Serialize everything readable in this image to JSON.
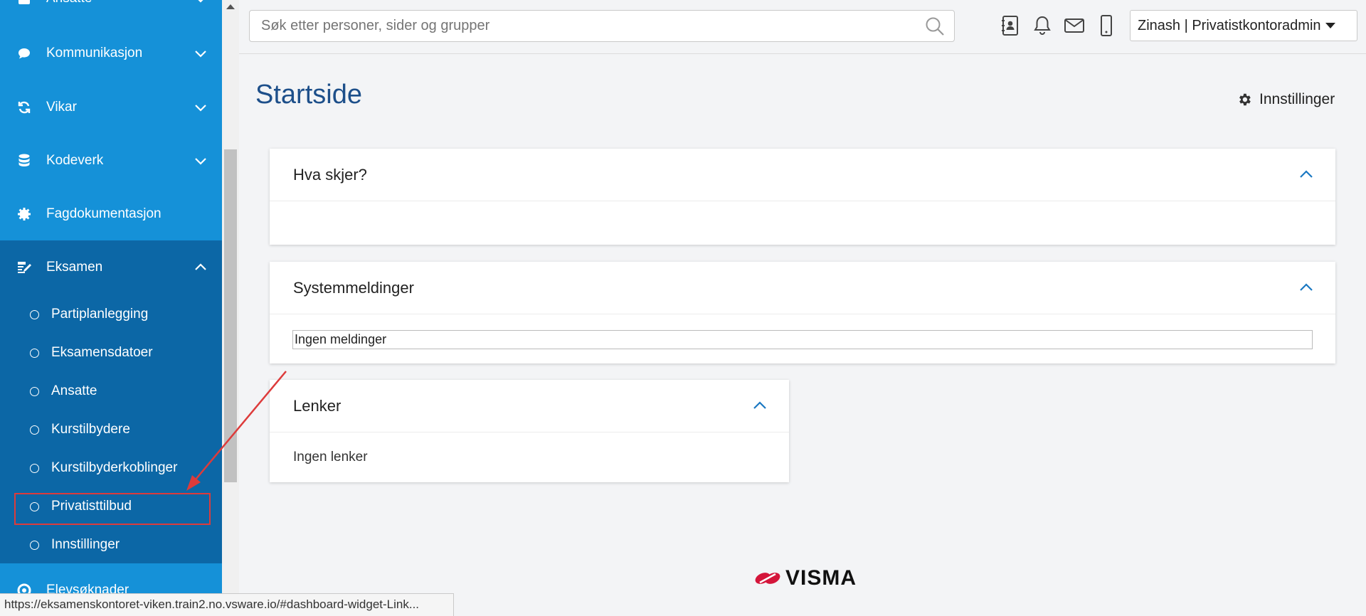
{
  "sidebar": {
    "items": [
      {
        "label": "Ansatte",
        "icon": "id-card-icon"
      },
      {
        "label": "Kommunikasjon",
        "icon": "chat-bubble-icon"
      },
      {
        "label": "Vikar",
        "icon": "refresh-icon"
      },
      {
        "label": "Kodeverk",
        "icon": "database-icon"
      },
      {
        "label": "Fagdokumentasjon",
        "icon": "gear-icon"
      },
      {
        "label": "Eksamen",
        "icon": "edit-document-icon"
      },
      {
        "label": "Elevsøknader",
        "icon": "life-ring-icon"
      }
    ],
    "subitems": [
      {
        "label": "Partiplanlegging"
      },
      {
        "label": "Eksamensdatoer"
      },
      {
        "label": "Ansatte"
      },
      {
        "label": "Kurstilbydere"
      },
      {
        "label": "Kurstilbyderkoblinger"
      },
      {
        "label": "Privatisttilbud",
        "highlighted": true
      },
      {
        "label": "Innstillinger"
      }
    ]
  },
  "topbar": {
    "search_placeholder": "Søk etter personer, sider og grupper",
    "user_label": "Zinash | Privatistkontoradmin"
  },
  "page": {
    "title": "Startside",
    "settings_label": "Innstillinger"
  },
  "cards": {
    "hva_skjer": {
      "title": "Hva skjer?"
    },
    "systemmeldinger": {
      "title": "Systemmeldinger",
      "message": "Ingen meldinger"
    },
    "lenker": {
      "title": "Lenker",
      "message": "Ingen lenker"
    }
  },
  "footer": {
    "logo_text": "VISMA"
  },
  "statusbar": {
    "url": "https://eksamenskontoret-viken.train2.no.vsware.io/#dashboard-widget-Link..."
  },
  "colors": {
    "sidebar": "#1591d8",
    "sidebar_active": "#0c67a6",
    "title": "#1d4f8a",
    "annotation": "#dd3b3b",
    "logo_red": "#d4153a"
  }
}
